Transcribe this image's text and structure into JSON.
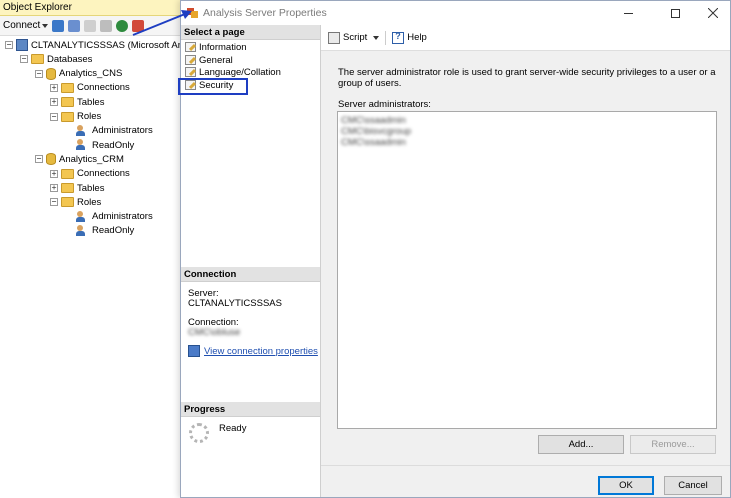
{
  "object_explorer": {
    "title": "Object Explorer",
    "connect_label": "Connect",
    "tree": [
      {
        "label": "CLTANALYTICSSSAS (Microsoft Ana",
        "level": 0,
        "icon": "server-icon",
        "expander": "−"
      },
      {
        "label": "Databases",
        "level": 1,
        "icon": "folder-icon",
        "expander": "−"
      },
      {
        "label": "Analytics_CNS",
        "level": 2,
        "icon": "database-icon",
        "expander": "−"
      },
      {
        "label": "Connections",
        "level": 3,
        "icon": "folder-icon",
        "expander": "+"
      },
      {
        "label": "Tables",
        "level": 3,
        "icon": "folder-icon",
        "expander": "+"
      },
      {
        "label": "Roles",
        "level": 3,
        "icon": "folder-icon",
        "expander": "−"
      },
      {
        "label": "Administrators",
        "level": 4,
        "icon": "role-icon",
        "expander": ""
      },
      {
        "label": "ReadOnly",
        "level": 4,
        "icon": "role-icon",
        "expander": ""
      },
      {
        "label": "Analytics_CRM",
        "level": 2,
        "icon": "database-icon",
        "expander": "−"
      },
      {
        "label": "Connections",
        "level": 3,
        "icon": "folder-icon",
        "expander": "+"
      },
      {
        "label": "Tables",
        "level": 3,
        "icon": "folder-icon",
        "expander": "+"
      },
      {
        "label": "Roles",
        "level": 3,
        "icon": "folder-icon",
        "expander": "−"
      },
      {
        "label": "Administrators",
        "level": 4,
        "icon": "role-icon",
        "expander": ""
      },
      {
        "label": "ReadOnly",
        "level": 4,
        "icon": "role-icon",
        "expander": ""
      }
    ]
  },
  "dialog": {
    "title": "Analysis Server Properties",
    "select_page_header": "Select a page",
    "pages": [
      {
        "label": "Information"
      },
      {
        "label": "General"
      },
      {
        "label": "Language/Collation"
      },
      {
        "label": "Security"
      }
    ],
    "connection": {
      "header": "Connection",
      "server_label": "Server:",
      "server_value": "CLTANALYTICSSSAS",
      "connection_label": "Connection:",
      "connection_value": "CMC\\obluse",
      "view_properties_link": "View connection properties"
    },
    "progress": {
      "header": "Progress",
      "status": "Ready"
    },
    "toolbar": {
      "script_label": "Script",
      "help_label": "Help"
    },
    "description": "The server administrator role is used to grant server-wide security privileges to a user or a group of users.",
    "admins_label": "Server administrators:",
    "admins": [
      "CMC\\ssaadmin",
      "CMC\\bisvcgroup",
      "CMC\\ssaadmin"
    ],
    "add_label": "Add...",
    "remove_label": "Remove...",
    "ok_label": "OK",
    "cancel_label": "Cancel"
  },
  "colors": {
    "highlight_box": "#1e3ec2",
    "oe_title_bg": "#fdf4bf",
    "link": "#1f4fb0"
  }
}
